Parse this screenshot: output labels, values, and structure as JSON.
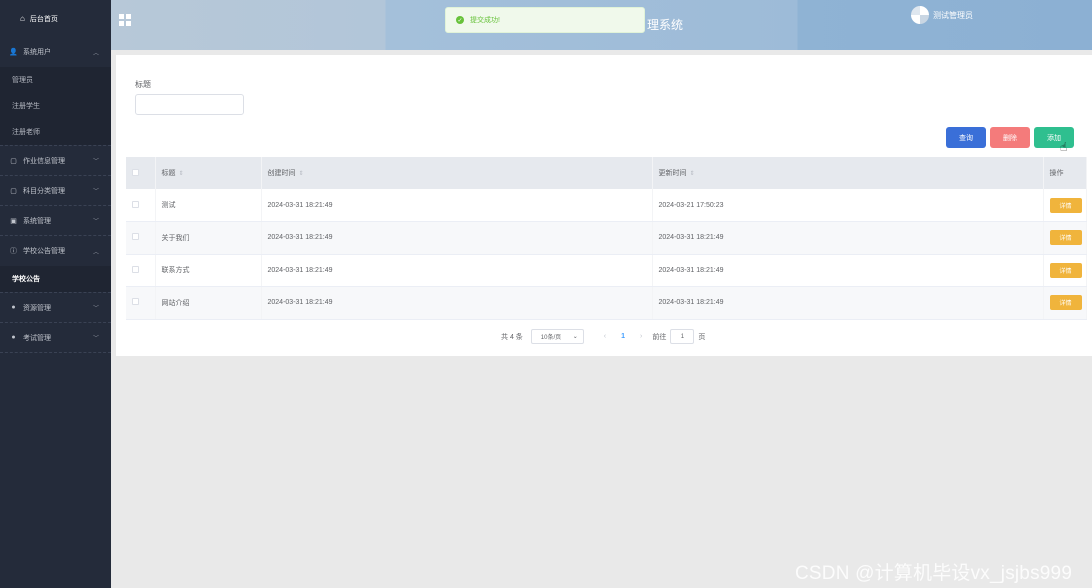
{
  "sidebar": {
    "home": {
      "icon": "home-icon",
      "label": "后台首页"
    },
    "system_users": {
      "icon": "user-icon",
      "label": "系统用户",
      "children": [
        "管理员",
        "注册学生",
        "注册老师"
      ]
    },
    "items": [
      {
        "icon": "document-icon",
        "label": "作业信息管理"
      },
      {
        "icon": "document-icon",
        "label": "科目分类管理"
      },
      {
        "icon": "image-icon",
        "label": "系统管理"
      }
    ],
    "notice": {
      "icon": "info-circle-icon",
      "label": "学校公告管理",
      "children": [
        "学校公告"
      ]
    },
    "bottom": [
      {
        "icon": "location-icon",
        "label": "资源管理"
      },
      {
        "icon": "location-icon",
        "label": "考试管理"
      }
    ]
  },
  "header": {
    "system_title": "理系统",
    "admin_name": "测试管理员"
  },
  "toast": {
    "message": "提交成功!"
  },
  "search": {
    "label": "标题",
    "value": ""
  },
  "toolbar": {
    "query": "查询",
    "delete": "删除",
    "add": "添加"
  },
  "table": {
    "columns": [
      "标题",
      "创建时间",
      "更新时间",
      "操作"
    ],
    "rows": [
      {
        "title": "测试",
        "created": "2024-03-31 18:21:49",
        "updated": "2024-03-21 17:50:23",
        "action": "详情"
      },
      {
        "title": "关于我们",
        "created": "2024-03-31 18:21:49",
        "updated": "2024-03-31 18:21:49",
        "action": "详情"
      },
      {
        "title": "联系方式",
        "created": "2024-03-31 18:21:49",
        "updated": "2024-03-31 18:21:49",
        "action": "详情"
      },
      {
        "title": "网站介绍",
        "created": "2024-03-31 18:21:49",
        "updated": "2024-03-31 18:21:49",
        "action": "详情"
      }
    ]
  },
  "pagination": {
    "total": "共 4 条",
    "page_size": "10条/页",
    "current": "1",
    "goto_prefix": "前往",
    "goto_value": "1",
    "goto_suffix": "页"
  },
  "watermark": "CSDN @计算机毕设vx_jsjbs999"
}
